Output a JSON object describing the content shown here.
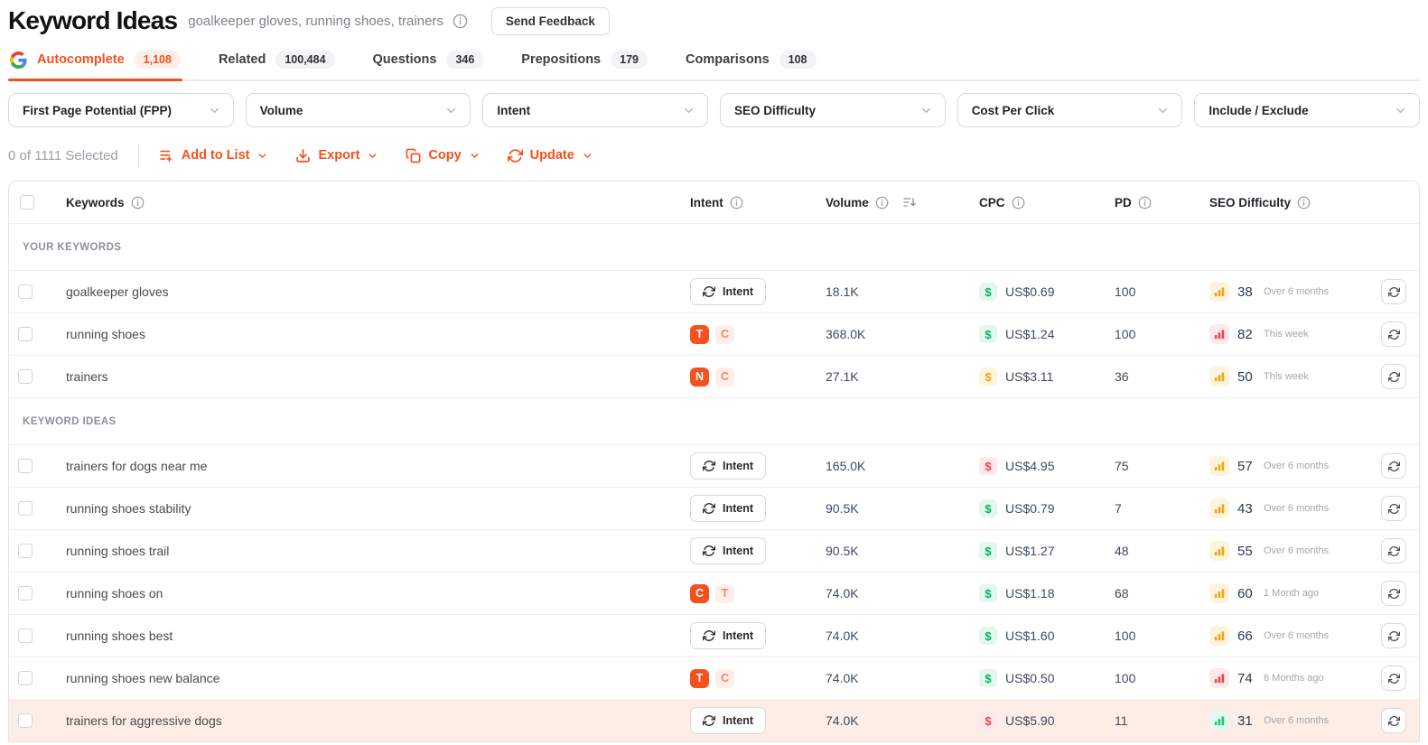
{
  "header": {
    "title": "Keyword Ideas",
    "subtitle": "goalkeeper gloves, running shoes, trainers",
    "feedback_button": "Send Feedback"
  },
  "tabs": [
    {
      "label": "Autocomplete",
      "count": "1,108",
      "active": true
    },
    {
      "label": "Related",
      "count": "100,484",
      "active": false
    },
    {
      "label": "Questions",
      "count": "346",
      "active": false
    },
    {
      "label": "Prepositions",
      "count": "179",
      "active": false
    },
    {
      "label": "Comparisons",
      "count": "108",
      "active": false
    }
  ],
  "filters": [
    "First Page Potential (FPP)",
    "Volume",
    "Intent",
    "SEO Difficulty",
    "Cost Per Click",
    "Include / Exclude"
  ],
  "toolbar": {
    "selection": "0 of 1111 Selected",
    "actions": [
      {
        "label": "Add to List",
        "icon": "add-to-list-icon"
      },
      {
        "label": "Export",
        "icon": "export-icon"
      },
      {
        "label": "Copy",
        "icon": "copy-icon"
      },
      {
        "label": "Update",
        "icon": "update-icon"
      }
    ]
  },
  "table": {
    "columns": {
      "keywords": "Keywords",
      "intent": "Intent",
      "volume": "Volume",
      "cpc": "CPC",
      "pd": "PD",
      "seo_difficulty": "SEO Difficulty"
    },
    "sections": [
      {
        "label": "YOUR KEYWORDS",
        "rows": [
          {
            "keyword": "goalkeeper gloves",
            "intent": {
              "type": "button",
              "label": "Intent"
            },
            "volume": "18.1K",
            "cpc": {
              "value": "US$0.69",
              "level": "green"
            },
            "pd": "100",
            "seo": {
              "value": "38",
              "level": "orange",
              "updated": "Over 6 months"
            },
            "highlighted": false
          },
          {
            "keyword": "running shoes",
            "intent": {
              "type": "badges",
              "badges": [
                {
                  "letter": "T",
                  "style": "solid"
                },
                {
                  "letter": "C",
                  "style": "light"
                }
              ]
            },
            "volume": "368.0K",
            "cpc": {
              "value": "US$1.24",
              "level": "green"
            },
            "pd": "100",
            "seo": {
              "value": "82",
              "level": "red",
              "updated": "This week"
            },
            "highlighted": false
          },
          {
            "keyword": "trainers",
            "intent": {
              "type": "badges",
              "badges": [
                {
                  "letter": "N",
                  "style": "solid"
                },
                {
                  "letter": "C",
                  "style": "light"
                }
              ]
            },
            "volume": "27.1K",
            "cpc": {
              "value": "US$3.11",
              "level": "amber"
            },
            "pd": "36",
            "seo": {
              "value": "50",
              "level": "orange",
              "updated": "This week"
            },
            "highlighted": false
          }
        ]
      },
      {
        "label": "KEYWORD IDEAS",
        "rows": [
          {
            "keyword": "trainers for dogs near me",
            "intent": {
              "type": "button",
              "label": "Intent"
            },
            "volume": "165.0K",
            "cpc": {
              "value": "US$4.95",
              "level": "red"
            },
            "pd": "75",
            "seo": {
              "value": "57",
              "level": "orange",
              "updated": "Over 6 months"
            },
            "highlighted": false
          },
          {
            "keyword": "running shoes stability",
            "intent": {
              "type": "button",
              "label": "Intent"
            },
            "volume": "90.5K",
            "cpc": {
              "value": "US$0.79",
              "level": "green"
            },
            "pd": "7",
            "seo": {
              "value": "43",
              "level": "orange",
              "updated": "Over 6 months"
            },
            "highlighted": false
          },
          {
            "keyword": "running shoes trail",
            "intent": {
              "type": "button",
              "label": "Intent"
            },
            "volume": "90.5K",
            "cpc": {
              "value": "US$1.27",
              "level": "green"
            },
            "pd": "48",
            "seo": {
              "value": "55",
              "level": "orange",
              "updated": "Over 6 months"
            },
            "highlighted": false
          },
          {
            "keyword": "running shoes on",
            "intent": {
              "type": "badges",
              "badges": [
                {
                  "letter": "C",
                  "style": "solid"
                },
                {
                  "letter": "T",
                  "style": "light"
                }
              ]
            },
            "volume": "74.0K",
            "cpc": {
              "value": "US$1.18",
              "level": "green"
            },
            "pd": "68",
            "seo": {
              "value": "60",
              "level": "orange",
              "updated": "1 Month ago"
            },
            "highlighted": false
          },
          {
            "keyword": "running shoes best",
            "intent": {
              "type": "button",
              "label": "Intent"
            },
            "volume": "74.0K",
            "cpc": {
              "value": "US$1.60",
              "level": "green"
            },
            "pd": "100",
            "seo": {
              "value": "66",
              "level": "orange",
              "updated": "Over 6 months"
            },
            "highlighted": false
          },
          {
            "keyword": "running shoes new balance",
            "intent": {
              "type": "badges",
              "badges": [
                {
                  "letter": "T",
                  "style": "solid"
                },
                {
                  "letter": "C",
                  "style": "light"
                }
              ]
            },
            "volume": "74.0K",
            "cpc": {
              "value": "US$0.50",
              "level": "green"
            },
            "pd": "100",
            "seo": {
              "value": "74",
              "level": "red",
              "updated": "6 Months ago"
            },
            "highlighted": false
          },
          {
            "keyword": "trainers for aggressive dogs",
            "intent": {
              "type": "button",
              "label": "Intent"
            },
            "volume": "74.0K",
            "cpc": {
              "value": "US$5.90",
              "level": "red"
            },
            "pd": "11",
            "seo": {
              "value": "31",
              "level": "green",
              "updated": "Over 6 months"
            },
            "highlighted": true
          }
        ]
      }
    ]
  },
  "colors": {
    "accent": "#f4511e",
    "accent_soft_bg": "#fdeee7",
    "accent_soft_text": "#f1876a",
    "green": "#00b36b",
    "green_bg": "#e4f6ed",
    "amber": "#f2a516",
    "amber_bg": "#fdf4dd",
    "red": "#ef4056",
    "red_bg": "#fde9ec",
    "seo_green": "#1ec77e",
    "seo_green_bg": "#e6f9f0",
    "row_highlight": "#fcede6",
    "text_dark": "#202124",
    "text_body": "#4a4a4a",
    "text_number": "#3e4b5d",
    "text_muted": "#9aa0a6",
    "border": "#e5e5e5"
  }
}
